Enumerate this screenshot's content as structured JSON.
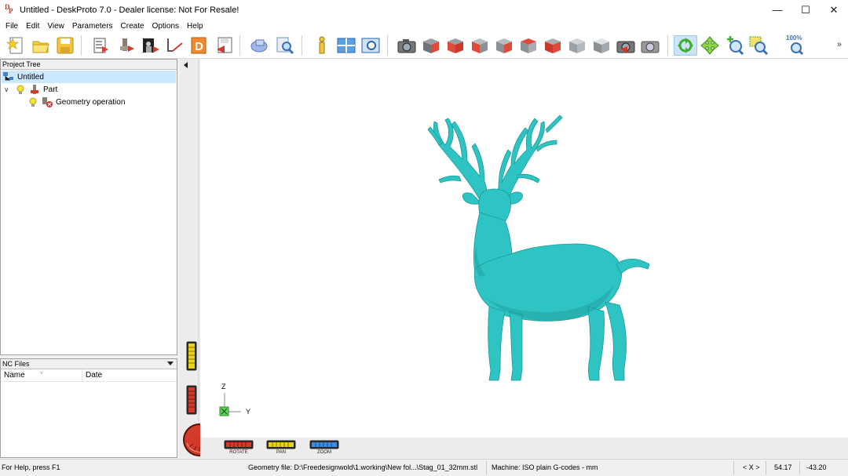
{
  "window": {
    "title": "Untitled - DeskProto 7.0 - Dealer license: Not For Resale!",
    "controls": [
      "minimize",
      "maximize",
      "close"
    ]
  },
  "menu": [
    "File",
    "Edit",
    "View",
    "Parameters",
    "Create",
    "Options",
    "Help"
  ],
  "toolbar": {
    "zoom_percent_label": "100%",
    "active_tool": "rotate"
  },
  "project_tree": {
    "header": "Project Tree",
    "items": [
      {
        "label": "Untitled",
        "level": 0,
        "selected": true
      },
      {
        "label": "Part",
        "level": 1,
        "expanded": true
      },
      {
        "label": "Geometry operation",
        "level": 2
      }
    ]
  },
  "nc_files": {
    "header": "NC Files",
    "columns": [
      "Name",
      "Date"
    ]
  },
  "viewport": {
    "model": "stag",
    "model_color": "#2ec4c4",
    "axes": {
      "z": "Z",
      "y": "Y"
    },
    "controls": {
      "rotate": "ROTATE",
      "pan": "PAN",
      "zoom": "ZOOM"
    }
  },
  "status": {
    "help": "For Help, press F1",
    "geometry_file": "Geometry file: D:\\Freedesignwold\\1.working\\New fol...\\Stag_01_32mm.stl",
    "machine": "Machine: ISO plain G-codes - mm",
    "axis_toggle": "< X >",
    "coord_a": "54.17",
    "coord_b": "-43.20"
  }
}
